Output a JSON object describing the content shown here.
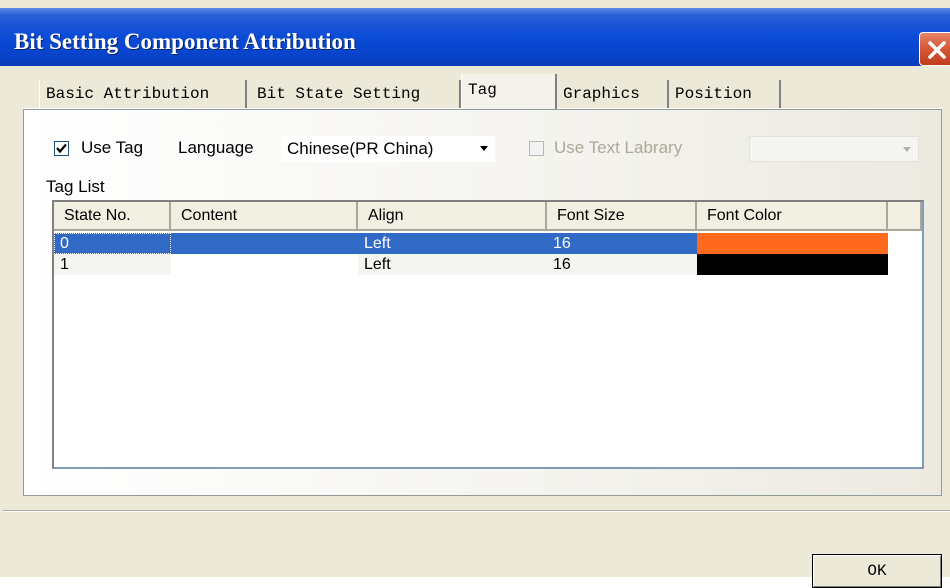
{
  "window": {
    "title": "Bit Setting Component Attribution"
  },
  "tabs": [
    {
      "label": "Basic Attribution"
    },
    {
      "label": "Bit State Setting"
    },
    {
      "label": "Tag"
    },
    {
      "label": "Graphics"
    },
    {
      "label": "Position"
    }
  ],
  "active_tab": "Tag",
  "tag_page": {
    "use_tag": {
      "label": "Use Tag",
      "checked": true
    },
    "language": {
      "label": "Language",
      "value": "Chinese(PR China)"
    },
    "use_text_library": {
      "label": "Use Text Labrary",
      "checked": false,
      "enabled": false
    },
    "text_library_combo": {
      "value": "",
      "enabled": false
    },
    "tag_list_label": "Tag List",
    "columns": [
      "State No.",
      "Content",
      "Align",
      "Font Size",
      "Font Color"
    ],
    "rows": [
      {
        "state": "0",
        "content": "",
        "align": "Left",
        "font_size": "16",
        "font_color": "#ff6a1f",
        "selected": true
      },
      {
        "state": "1",
        "content": "",
        "align": "Left",
        "font_size": "16",
        "font_color": "#000000",
        "selected": false
      }
    ]
  },
  "buttons": {
    "ok": "OK"
  },
  "colors": {
    "title_bar": "#0a4bd6",
    "selection": "#316ac5",
    "close_button": "#d65b3a"
  }
}
